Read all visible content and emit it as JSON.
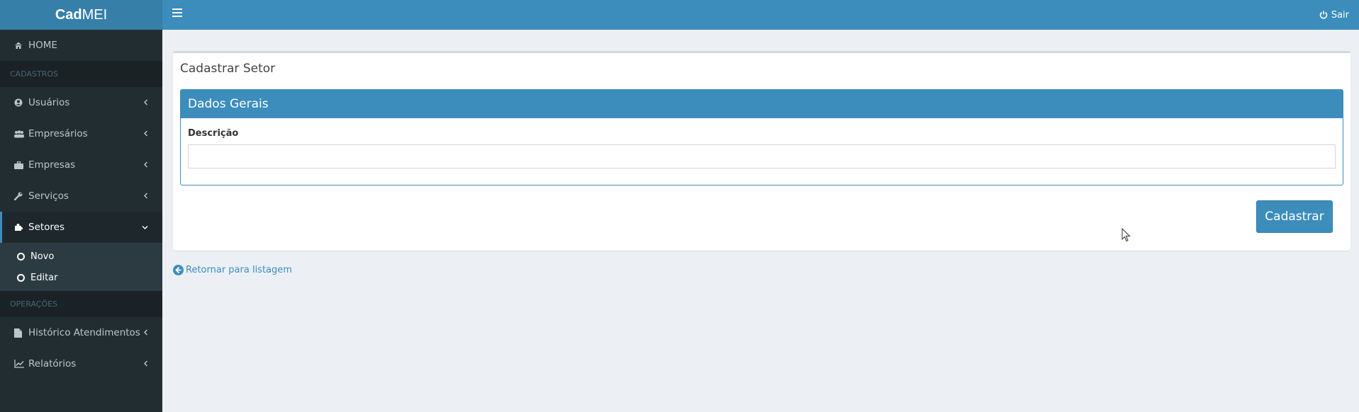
{
  "app": {
    "logo_bold": "Cad",
    "logo_light": "MEI"
  },
  "header": {
    "logout_label": "Sair",
    "menu_icon": "hamburger-icon",
    "logout_icon": "power-icon"
  },
  "sidebar": {
    "home": "HOME",
    "section_cadastros": "CADASTROS",
    "items": [
      {
        "label": "Usuários",
        "icon": "user-circle-icon"
      },
      {
        "label": "Empresários",
        "icon": "users-icon"
      },
      {
        "label": "Empresas",
        "icon": "briefcase-icon"
      },
      {
        "label": "Serviços",
        "icon": "wrench-icon"
      },
      {
        "label": "Setores",
        "icon": "puzzle-icon"
      }
    ],
    "submenu": [
      {
        "label": "Novo"
      },
      {
        "label": "Editar"
      }
    ],
    "section_operacoes": "OPERAÇÕES",
    "ops_items": [
      {
        "label": "Histórico Atendimentos",
        "icon": "file-icon"
      },
      {
        "label": "Relatórios",
        "icon": "line-chart-icon"
      }
    ]
  },
  "main": {
    "title": "Cadastrar Setor",
    "panel_title": "Dados Gerais",
    "field_label": "Descrição",
    "field_value": "",
    "submit_label": "Cadastrar",
    "back_label": "Retornar para listagem"
  },
  "colors": {
    "primary": "#3c8dbc",
    "sidebar_bg": "#222d32",
    "content_bg": "#ecf0f5"
  }
}
